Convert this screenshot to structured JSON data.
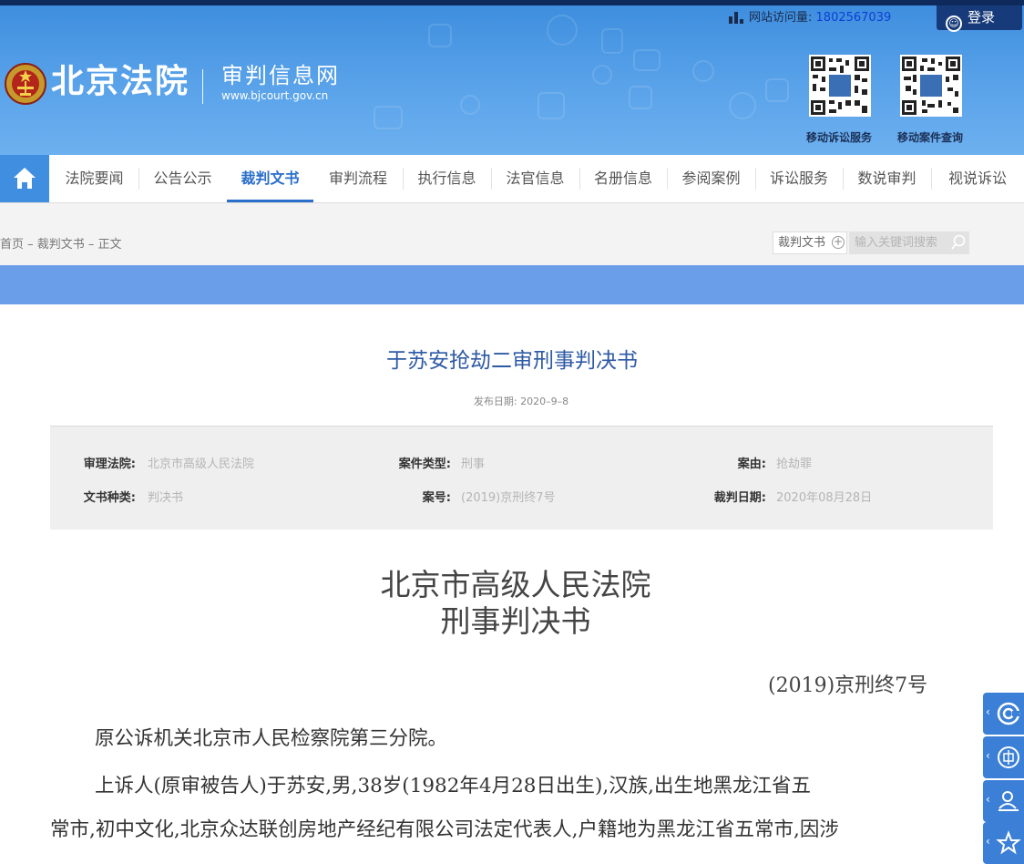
{
  "header": {
    "logo_text": "北京法院",
    "subtitle": "审判信息网",
    "url": "www.bjcourt.gov.cn",
    "visit_label": "网站访问量:",
    "visit_count": "1802567039",
    "login_label": "登录",
    "qr_codes": [
      {
        "label": "移动诉讼服务"
      },
      {
        "label": "移动案件查询"
      }
    ]
  },
  "nav": {
    "home_icon": "home-icon",
    "items": [
      "法院要闻",
      "公告公示",
      "裁判文书",
      "审判流程",
      "执行信息",
      "法官信息",
      "名册信息",
      "参阅案例",
      "诉讼服务",
      "数说审判",
      "视说诉讼"
    ],
    "active": "裁判文书"
  },
  "breadcrumb": "首页 – 裁判文书 – 正文",
  "search": {
    "scope": "裁判文书",
    "placeholder": "输入关键词搜索"
  },
  "document": {
    "title": "于苏安抢劫二审刑事判决书",
    "publish_date": "发布日期:  2020–9–8",
    "meta": {
      "court_label": "审理法院:",
      "court_value": "北京市高级人民法院",
      "case_type_label": "案件类型:",
      "case_type_value": "刑事",
      "cause_label": "案由:",
      "cause_value": "抢劫罪",
      "doc_type_label": "文书种类:",
      "doc_type_value": "判决书",
      "case_no_label": "案号:",
      "case_no_value": "(2019)京刑终7号",
      "judgment_date_label": "裁判日期:",
      "judgment_date_value": "2020年08月28日"
    },
    "court_name": "北京市高级人民法院",
    "doc_kind": "刑事判决书",
    "case_number": "(2019)京刑终7号",
    "paragraphs": [
      "原公诉机关北京市人民检察院第三分院。",
      "上诉人(原审被告人)于苏安,男,38岁(1982年4月28日出生),汉族,出生地黑龙江省五",
      "常市,初中文化,北京众达联创房地产经纪有限公司法定代表人,户籍地为黑龙江省五常市,因涉"
    ]
  },
  "float_tools": [
    "c-icon",
    "emblem-icon",
    "user-icon",
    "star-icon"
  ]
}
